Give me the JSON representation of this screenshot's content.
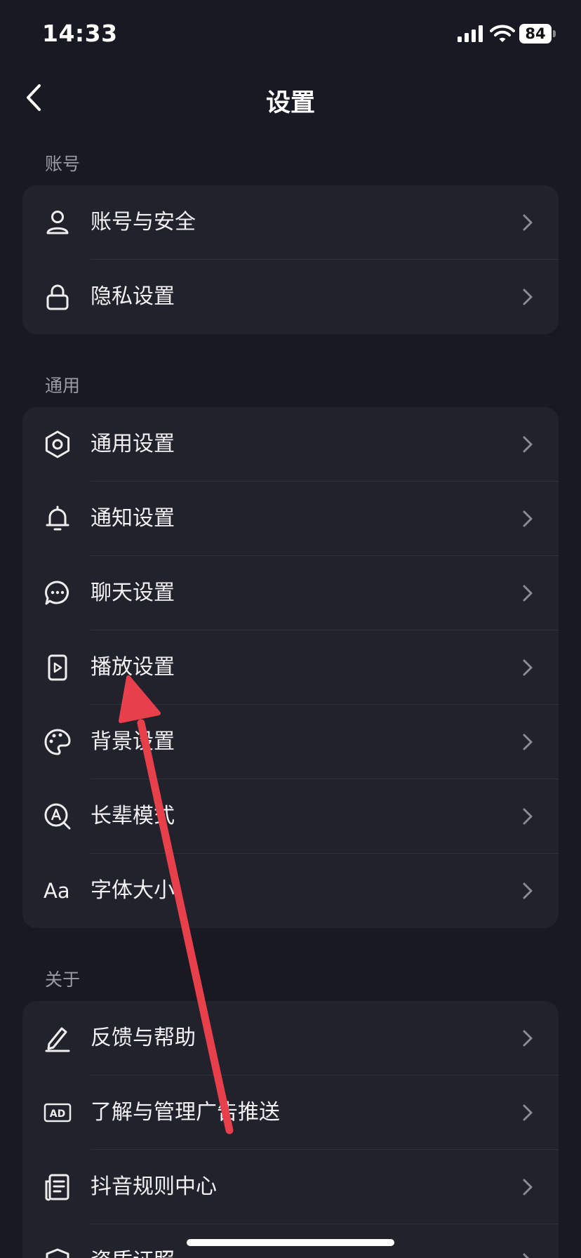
{
  "status_bar": {
    "time": "14:33",
    "battery": "84"
  },
  "nav": {
    "title": "设置"
  },
  "sections": [
    {
      "header": "账号",
      "items": [
        {
          "label": "账号与安全"
        },
        {
          "label": "隐私设置"
        }
      ]
    },
    {
      "header": "通用",
      "items": [
        {
          "label": "通用设置"
        },
        {
          "label": "通知设置"
        },
        {
          "label": "聊天设置"
        },
        {
          "label": "播放设置"
        },
        {
          "label": "背景设置"
        },
        {
          "label": "长辈模式"
        },
        {
          "label": "字体大小",
          "icon_text": "Aa"
        }
      ]
    },
    {
      "header": "关于",
      "items": [
        {
          "label": "反馈与帮助"
        },
        {
          "label": "了解与管理广告推送",
          "icon_text": "AD"
        },
        {
          "label": "抖音规则中心"
        },
        {
          "label": "资质证照"
        }
      ]
    }
  ],
  "colors": {
    "background": "#181922",
    "card": "#21222c",
    "divider": "#30313b",
    "annotation_arrow": "#e8404b"
  }
}
